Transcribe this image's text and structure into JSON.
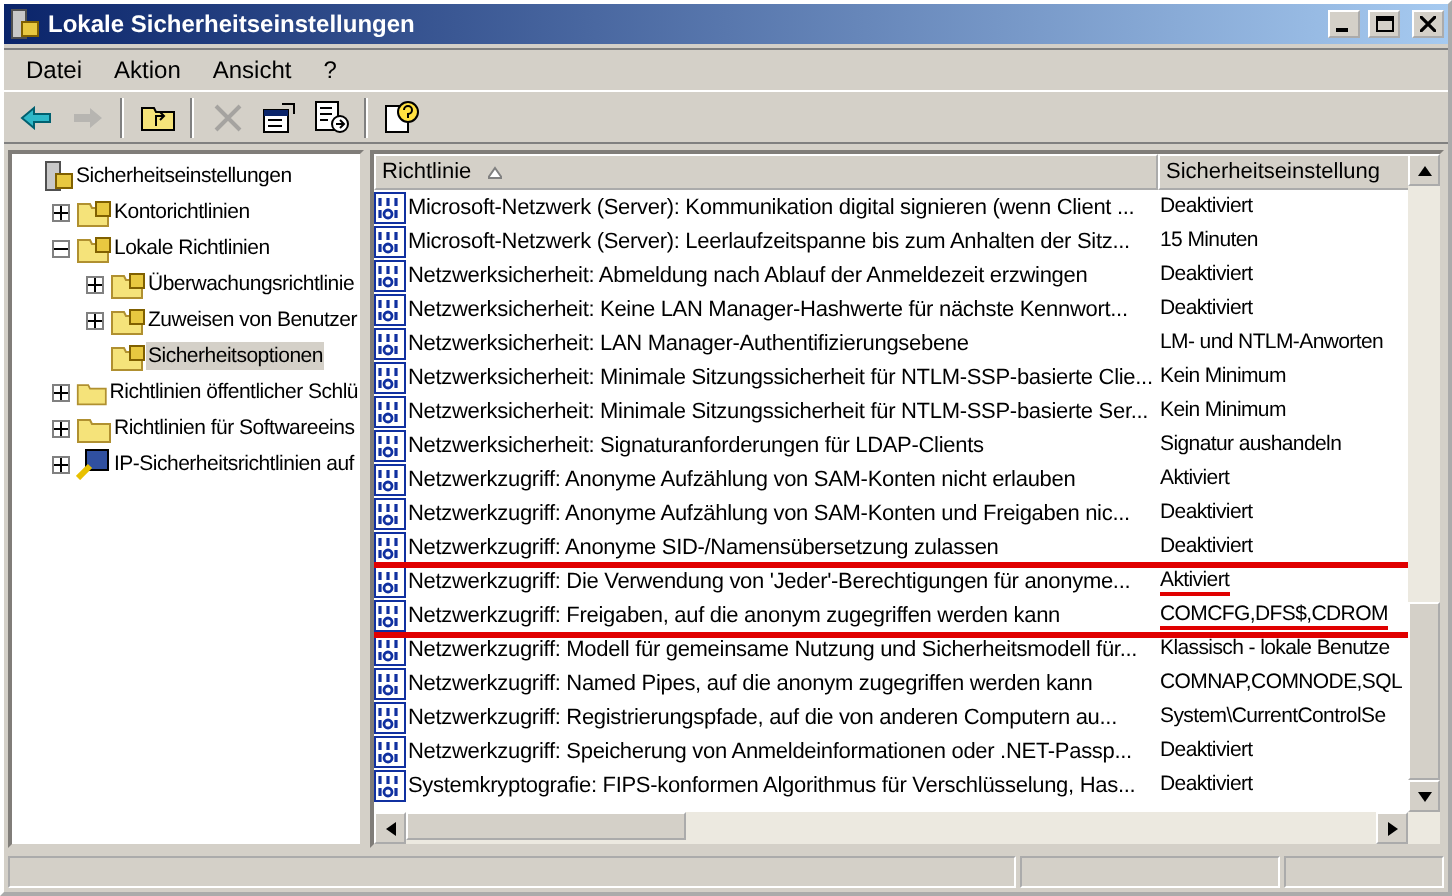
{
  "window": {
    "title": "Lokale Sicherheitseinstellungen"
  },
  "menu": [
    "Datei",
    "Aktion",
    "Ansicht",
    "?"
  ],
  "toolbar": [
    {
      "kind": "back",
      "disabled": false
    },
    {
      "kind": "forward",
      "disabled": true
    },
    {
      "kind": "sep"
    },
    {
      "kind": "up",
      "disabled": false
    },
    {
      "kind": "sep"
    },
    {
      "kind": "delete",
      "disabled": true
    },
    {
      "kind": "properties",
      "disabled": false
    },
    {
      "kind": "export",
      "disabled": false
    },
    {
      "kind": "sep"
    },
    {
      "kind": "help",
      "disabled": false
    }
  ],
  "tree": [
    {
      "label": "Sicherheitseinstellungen",
      "kind": "computer",
      "selected": false,
      "children": [
        {
          "label": "Kontorichtlinien",
          "kind": "lockfolder",
          "selected": false,
          "expanded": false
        },
        {
          "label": "Lokale Richtlinien",
          "kind": "lockfolder",
          "selected": false,
          "expanded": true,
          "children": [
            {
              "label": "Überwachungsrichtlinie",
              "kind": "lockfolder",
              "selected": false,
              "expanded": false
            },
            {
              "label": "Zuweisen von Benutzer",
              "kind": "lockfolder",
              "selected": false,
              "expanded": false
            },
            {
              "label": "Sicherheitsoptionen",
              "kind": "lockfolder",
              "selected": true
            }
          ]
        },
        {
          "label": "Richtlinien öffentlicher Schlü",
          "kind": "folder",
          "selected": false,
          "expanded": false
        },
        {
          "label": "Richtlinien für Softwareeins",
          "kind": "folder",
          "selected": false,
          "expanded": false
        },
        {
          "label": "IP-Sicherheitsrichtlinien auf",
          "kind": "network",
          "selected": false,
          "expanded": false
        }
      ]
    }
  ],
  "table": {
    "columns": [
      "Richtlinie",
      "Sicherheitseinstellung"
    ],
    "rows": [
      {
        "policy": "Microsoft-Netzwerk (Server): Kommunikation digital signieren (wenn Client ...",
        "setting": "Deaktiviert",
        "highlighted": false,
        "underlined": false
      },
      {
        "policy": "Microsoft-Netzwerk (Server): Leerlaufzeitspanne bis zum Anhalten der Sitz...",
        "setting": "15 Minuten",
        "highlighted": false,
        "underlined": false
      },
      {
        "policy": "Netzwerksicherheit: Abmeldung nach Ablauf der Anmeldezeit erzwingen",
        "setting": "Deaktiviert",
        "highlighted": false,
        "underlined": false
      },
      {
        "policy": "Netzwerksicherheit: Keine LAN Manager-Hashwerte für nächste Kennwort...",
        "setting": "Deaktiviert",
        "highlighted": false,
        "underlined": false
      },
      {
        "policy": "Netzwerksicherheit: LAN Manager-Authentifizierungsebene",
        "setting": "LM- und NTLM-Anworten",
        "highlighted": false,
        "underlined": false
      },
      {
        "policy": "Netzwerksicherheit: Minimale Sitzungssicherheit für NTLM-SSP-basierte Clie...",
        "setting": "Kein Minimum",
        "highlighted": false,
        "underlined": false
      },
      {
        "policy": "Netzwerksicherheit: Minimale Sitzungssicherheit für NTLM-SSP-basierte Ser...",
        "setting": "Kein Minimum",
        "highlighted": false,
        "underlined": false
      },
      {
        "policy": "Netzwerksicherheit: Signaturanforderungen für LDAP-Clients",
        "setting": "Signatur aushandeln",
        "highlighted": false,
        "underlined": false
      },
      {
        "policy": "Netzwerkzugriff: Anonyme Aufzählung von SAM-Konten nicht erlauben",
        "setting": "Aktiviert",
        "highlighted": false,
        "underlined": false
      },
      {
        "policy": "Netzwerkzugriff: Anonyme Aufzählung von SAM-Konten und Freigaben nic...",
        "setting": "Deaktiviert",
        "highlighted": false,
        "underlined": false
      },
      {
        "policy": "Netzwerkzugriff: Anonyme SID-/Namensübersetzung zulassen",
        "setting": "Deaktiviert",
        "highlighted": false,
        "underlined": false
      },
      {
        "policy": "Netzwerkzugriff: Die Verwendung von 'Jeder'-Berechtigungen für anonyme...",
        "setting": "Aktiviert",
        "highlighted": true,
        "underlined": true
      },
      {
        "policy": "Netzwerkzugriff: Freigaben, auf die anonym zugegriffen werden kann",
        "setting": "COMCFG,DFS$,CDROM",
        "highlighted": true,
        "underlined": true
      },
      {
        "policy": "Netzwerkzugriff: Modell für gemeinsame Nutzung und Sicherheitsmodell für...",
        "setting": "Klassisch - lokale Benutze",
        "highlighted": false,
        "underlined": false
      },
      {
        "policy": "Netzwerkzugriff: Named Pipes, auf die anonym zugegriffen werden kann",
        "setting": "COMNAP,COMNODE,SQL",
        "highlighted": false,
        "underlined": false
      },
      {
        "policy": "Netzwerkzugriff: Registrierungspfade, auf die von anderen Computern au...",
        "setting": "System\\CurrentControlSe",
        "highlighted": false,
        "underlined": false
      },
      {
        "policy": "Netzwerkzugriff: Speicherung von Anmeldeinformationen oder .NET-Passp...",
        "setting": "Deaktiviert",
        "highlighted": false,
        "underlined": false
      },
      {
        "policy": "Systemkryptografie: FIPS-konformen Algorithmus für Verschlüsselung, Has...",
        "setting": "Deaktiviert",
        "highlighted": false,
        "underlined": false
      }
    ]
  }
}
